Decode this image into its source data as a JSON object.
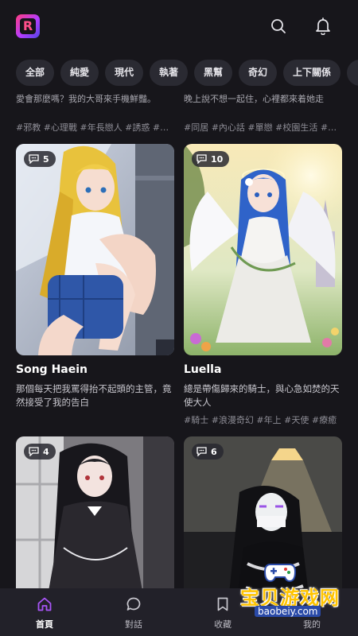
{
  "header": {
    "logo_letter": "R",
    "search_icon": "search-icon",
    "bell_icon": "bell-icon"
  },
  "chips": [
    "全部",
    "純愛",
    "現代",
    "執著",
    "黑幫",
    "奇幻",
    "上下關係"
  ],
  "peek": {
    "left_desc": "愛會那麼嗎？我的大哥來手機鮮豔。",
    "right_desc": "晚上說不想一起住，心裡都來着她走",
    "left_tags": "#邪教 #心理戰 #年長戀人 #誘惑 #…",
    "right_tags": "#同居 #內心話 #單戀 #校園生活 #…"
  },
  "cards": [
    {
      "count": "5",
      "name": "Song Haein",
      "desc": "那個每天把我罵得抬不起頭的主管，竟然接受了我的告白",
      "tags": ""
    },
    {
      "count": "10",
      "name": "Luella",
      "desc": "總是帶傷歸來的騎士，與心急如焚的天使大人",
      "tags": "#騎士 #浪漫奇幻 #年上 #天使 #療癒"
    },
    {
      "count": "4",
      "name": "",
      "desc": "",
      "tags": ""
    },
    {
      "count": "6",
      "name": "",
      "desc": "",
      "tags": ""
    }
  ],
  "tabs": [
    {
      "label": "首頁",
      "icon": "home-icon",
      "active": true
    },
    {
      "label": "對話",
      "icon": "chat-icon",
      "active": false
    },
    {
      "label": "收藏",
      "icon": "bookmark-icon",
      "active": false
    },
    {
      "label": "我的",
      "icon": "profile-icon",
      "active": false
    }
  ],
  "watermark": {
    "title": "宝贝游戏网",
    "url": "baobeiy.com"
  },
  "colors": {
    "background": "#17161b",
    "chip": "#2a2a32",
    "accent": "#a855f7",
    "watermark": "#ffc400"
  }
}
